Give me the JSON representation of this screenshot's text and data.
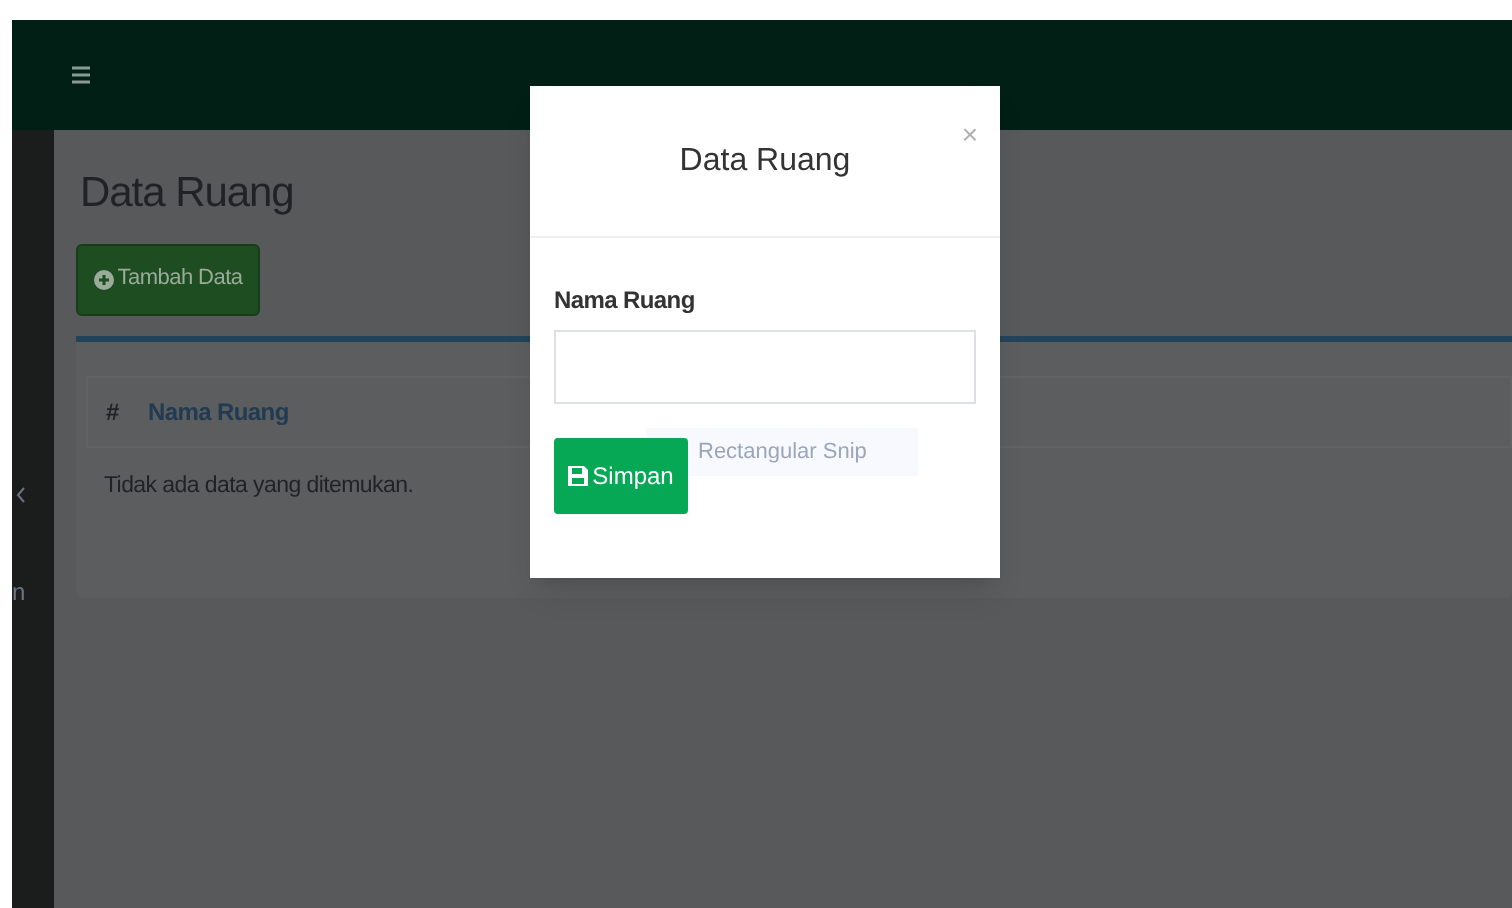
{
  "sidebar": {
    "fragment": "n"
  },
  "page": {
    "title": "Data Ruang",
    "add_button": "Tambah Data",
    "table": {
      "columns": [
        "#",
        "Nama Ruang"
      ],
      "empty_message": "Tidak ada data yang ditemukan."
    }
  },
  "modal": {
    "title": "Data Ruang",
    "close": "×",
    "field_label": "Nama Ruang",
    "save_button": "Simpan"
  },
  "tooltip": {
    "text": "Rectangular Snip"
  }
}
